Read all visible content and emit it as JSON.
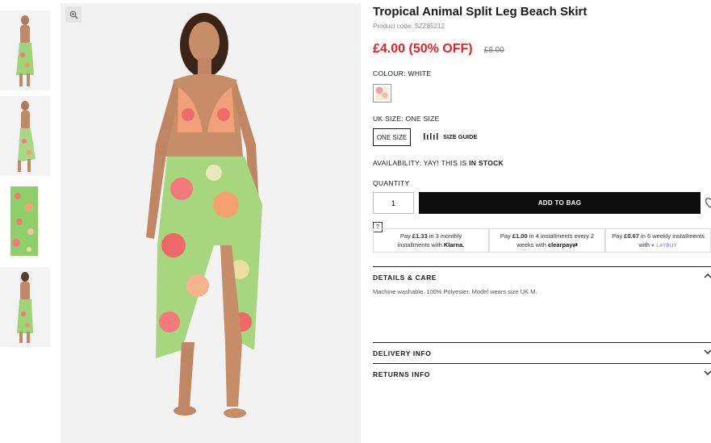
{
  "product": {
    "title": "Tropical Animal Split Leg Beach Skirt",
    "code": "Product code: SZZ85212",
    "price": "£4.00 (50% OFF)",
    "was_price": "£8.00"
  },
  "colour": {
    "label": "COLOUR: ",
    "value": "WHITE"
  },
  "size": {
    "label": "UK SIZE: ONE SIZE",
    "option": "ONE SIZE",
    "guide": "SIZE GUIDE"
  },
  "availability": {
    "label": "AVAILABILITY:  YAY! THIS IS ",
    "status": "IN STOCK"
  },
  "quantity": {
    "label": "QUANTITY",
    "value": "1"
  },
  "add_to_bag": "ADD TO BAG",
  "help": "?",
  "payments": [
    {
      "line1a": "Pay ",
      "amount": "£1.33",
      "line1b": " in 3 monthly",
      "line2": "installments with ",
      "brand": "Klarna."
    },
    {
      "line1a": "Pay ",
      "amount": "£1.00",
      "line1b": " in 4 installments every 2",
      "line2": "weeks with ",
      "brand": "clearpay"
    },
    {
      "line1a": "Pay ",
      "amount": "£0.67",
      "line1b": " in 6 weekly installments",
      "line2": "with ",
      "brand": "LAYBUY"
    }
  ],
  "details": {
    "title": "DETAILS & CARE",
    "text": "Machine washable. 100% Polyester. Model wears size UK M."
  },
  "delivery": {
    "title": "DELIVERY INFO"
  },
  "returns": {
    "title": "RETURNS INFO"
  },
  "colors": {
    "sale": "#e02424",
    "button": "#0d0d0d",
    "laybuy": "#7a58ff"
  },
  "icons": [
    "zoom-icon",
    "size-guide-icon",
    "heart-icon",
    "chevron-up-icon",
    "chevron-down-icon"
  ]
}
